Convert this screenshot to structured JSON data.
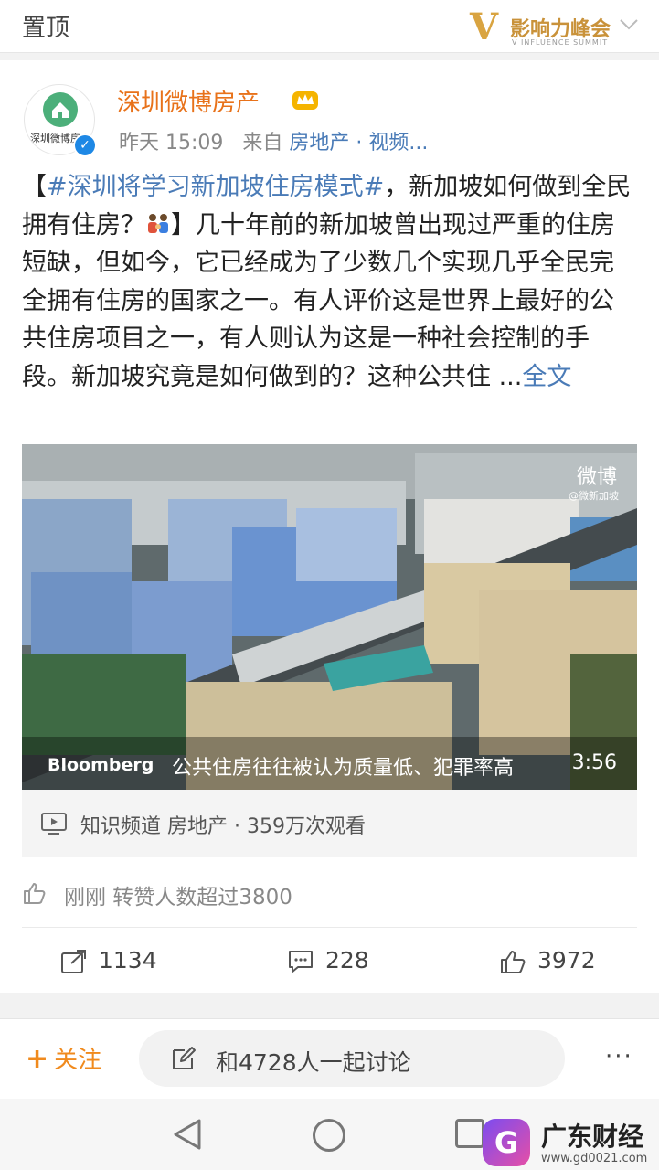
{
  "topbar": {
    "pinned_label": "置顶",
    "banner_logo_v": "V",
    "banner_logo_text": "影响力峰会",
    "banner_logo_sub": "V INFLUENCE SUMMIT"
  },
  "post": {
    "avatar_text": "深圳微博房产",
    "author": "深圳微博房产",
    "time": "昨天 15:09",
    "source_prefix": "来自",
    "source": "房地产 · 视频...",
    "content_lead": "【",
    "content_topic": "#深圳将学习新加坡住房模式#",
    "content_part1": "，新加坡如何做到全民拥有住房？",
    "content_part2": "】几十年前的新加坡曾出现过严重的住房短缺，但如今，它已经成为了少数几个实现几乎全民完全拥有住房的国家之一。有人评价这是世界上最好的公共住房项目之一，有人则认为这是一种社会控制的手段。新加坡究竟是如何做到的？这种公共住 ...",
    "content_more": "全文",
    "video": {
      "watermark": "微博",
      "watermark_sub": "@微新加坡",
      "brand": "Bloomberg",
      "caption": "公共住房往往被认为质量低、犯罪率高",
      "duration": "3:56"
    },
    "video_info": "知识频道 房地产 · 359万次观看",
    "likes_notice": "刚刚 转赞人数超过3800",
    "reposts": "1134",
    "comments": "228",
    "likes": "3972"
  },
  "bottombar": {
    "follow_plus": "+",
    "follow_label": "关注",
    "discuss_label": "和4728人一起讨论",
    "more": "···"
  },
  "watermark": {
    "logo": "G",
    "title": "广东财经",
    "url": "www.gd0021.com"
  },
  "colors": {
    "author": "#e8721a",
    "link": "#4a7bb7",
    "follow": "#f08a1d"
  }
}
